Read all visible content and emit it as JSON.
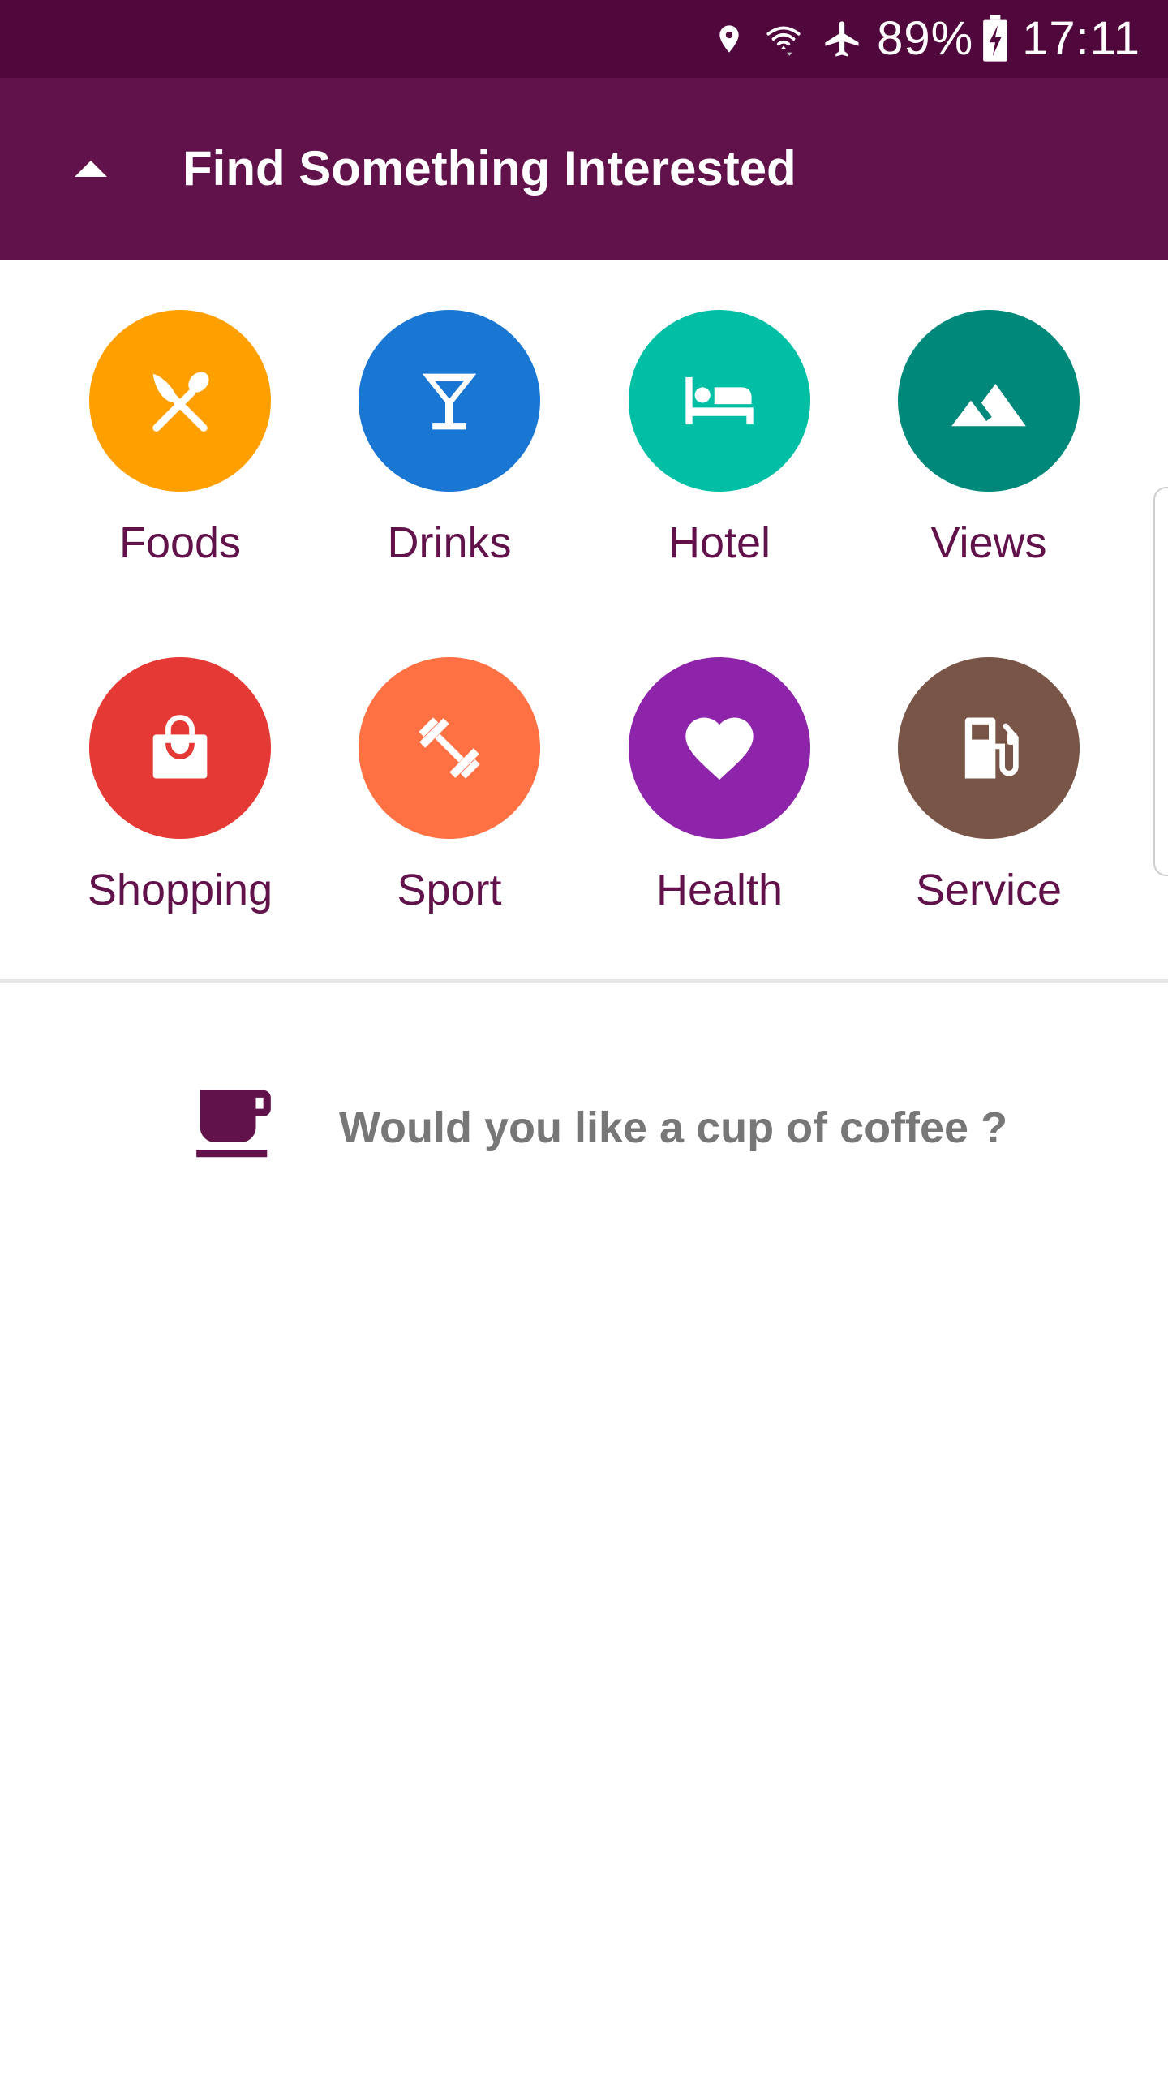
{
  "status_bar": {
    "icons": [
      "location-icon",
      "wifi-icon",
      "airplane-icon",
      "battery-charging-icon"
    ],
    "battery": "89%",
    "time": "17:11"
  },
  "app_bar": {
    "title": "Find Something Interested",
    "collapse_icon": "triangle-up-icon"
  },
  "categories": [
    {
      "label": "Foods",
      "icon": "utensils-icon",
      "color": "#ffa000"
    },
    {
      "label": "Drinks",
      "icon": "cocktail-icon",
      "color": "#1976d2"
    },
    {
      "label": "Hotel",
      "icon": "bed-icon",
      "color": "#00bfa5"
    },
    {
      "label": "Views",
      "icon": "landscape-icon",
      "color": "#00897b"
    },
    {
      "label": "Shopping",
      "icon": "shopping-bag-icon",
      "color": "#e53935"
    },
    {
      "label": "Sport",
      "icon": "dumbbell-icon",
      "color": "#ff7043"
    },
    {
      "label": "Health",
      "icon": "heart-icon",
      "color": "#8e24aa"
    },
    {
      "label": "Service",
      "icon": "gas-station-icon",
      "color": "#795548"
    }
  ],
  "coffee": {
    "icon": "coffee-cup-icon",
    "text": "Would you like a cup of coffee ?"
  },
  "colors": {
    "status_bar": "#50073c",
    "app_bar": "#62124a",
    "label": "#62124a",
    "prompt_text": "#777777"
  }
}
